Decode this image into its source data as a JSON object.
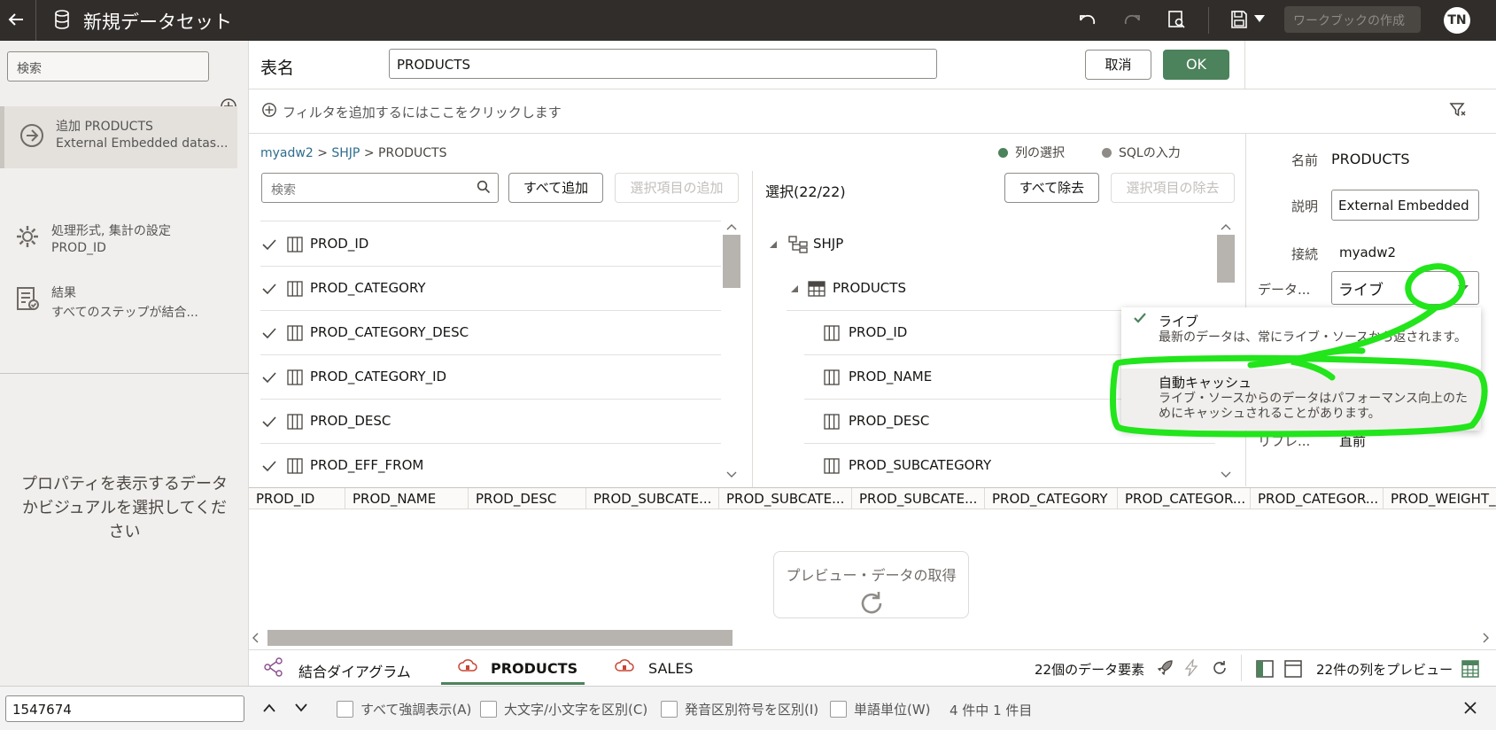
{
  "topbar": {
    "title": "新規データセット",
    "workbook_button": "ワークブックの作成",
    "avatar_initials": "TN"
  },
  "left_panel": {
    "search_placeholder": "検索",
    "steps": [
      {
        "title": "追加 PRODUCTS",
        "subtitle": "External Embedded datas..."
      },
      {
        "title": "処理形式, 集計の設定",
        "subtitle": "PROD_ID"
      },
      {
        "title": "結果",
        "subtitle": "すべてのステップが結合..."
      }
    ],
    "props_message": "プロパティを表示するデータかビジュアルを選択してください"
  },
  "header": {
    "table_label": "表名",
    "table_name": "PRODUCTS",
    "cancel": "取消",
    "ok": "OK",
    "filter_text": "フィルタを追加するにはここをクリックします"
  },
  "breadcrumb": {
    "conn": "myadw2",
    "schema": "SHJP",
    "table": "PRODUCTS",
    "sep": ">"
  },
  "mode": {
    "columns": "列の選択",
    "sql": "SQLの入力"
  },
  "left_columns": {
    "search_placeholder": "検索",
    "add_all": "すべて追加",
    "add_selected": "選択項目の追加",
    "items": [
      "PROD_ID",
      "PROD_CATEGORY",
      "PROD_CATEGORY_DESC",
      "PROD_CATEGORY_ID",
      "PROD_DESC",
      "PROD_EFF_FROM"
    ]
  },
  "right_columns": {
    "selected_count": "選択(22/22)",
    "remove_all": "すべて除去",
    "remove_selected": "選択項目の除去",
    "schema": "SHJP",
    "table": "PRODUCTS",
    "items": [
      "PROD_ID",
      "PROD_NAME",
      "PROD_DESC",
      "PROD_SUBCATEGORY"
    ]
  },
  "properties": {
    "name_label": "名前",
    "name_value": "PRODUCTS",
    "desc_label": "説明",
    "desc_value": "External Embedded",
    "conn_label": "接続",
    "conn_value": "myadw2",
    "data_label": "データ...",
    "data_value": "ライブ",
    "refresh_label": "リフレ...",
    "refresh_value": "直前"
  },
  "dropdown": {
    "options": [
      {
        "title": "ライブ",
        "desc": "最新のデータは、常にライブ・ソースから返されます。",
        "selected": true
      },
      {
        "title": "自動キャッシュ",
        "desc": "ライブ・ソースからのデータはパフォーマンス向上のためにキャッシュされることがあります。",
        "selected": false
      }
    ]
  },
  "grid": {
    "columns": [
      "PROD_ID",
      "PROD_NAME",
      "PROD_DESC",
      "PROD_SUBCATE...",
      "PROD_SUBCATE...",
      "PROD_SUBCATE...",
      "PROD_CATEGORY",
      "PROD_CATEGOR...",
      "PROD_CATEGOR...",
      "PROD_WEIGHT_"
    ],
    "preview_button": "プレビュー・データの取得"
  },
  "bottom_tabs": {
    "join_diagram": "結合ダイアグラム",
    "tab_products": "PRODUCTS",
    "tab_sales": "SALES",
    "element_count": "22個のデータ要素",
    "preview_cols": "22件の列をプレビュー"
  },
  "findbar": {
    "query": "1547674",
    "highlight_all": "すべて強調表示(A)",
    "match_case": "大文字/小文字を区別(C)",
    "diacritics": "発音区別符号を区別(I)",
    "whole_words": "単語単位(W)",
    "result": "4 件中 1 件目"
  },
  "colors": {
    "topbar": "#312d2a",
    "ok_button": "#4c825c",
    "link": "#2e6d8e",
    "annotation": "#22e51b"
  }
}
